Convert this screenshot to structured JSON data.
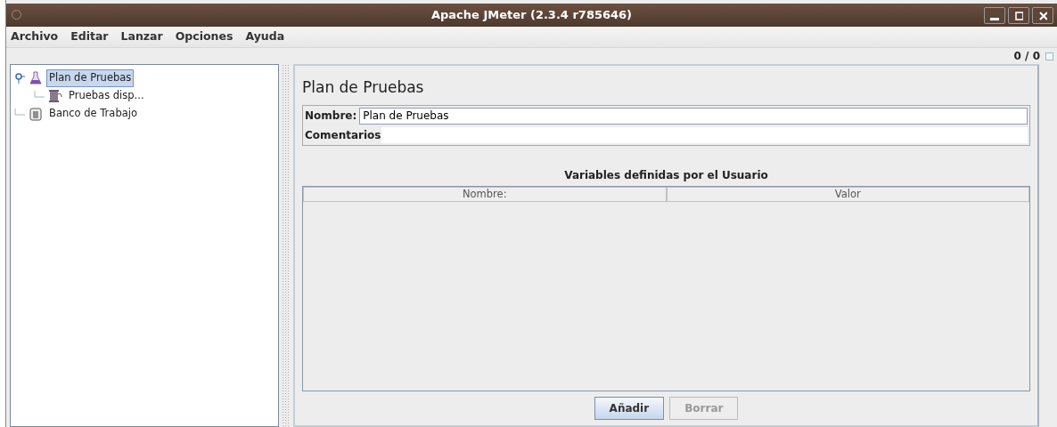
{
  "window": {
    "title": "Apache JMeter (2.3.4 r785646)"
  },
  "menu": [
    {
      "label": "Archivo"
    },
    {
      "label": "Editar"
    },
    {
      "label": "Lanzar"
    },
    {
      "label": "Opciones"
    },
    {
      "label": "Ayuda"
    }
  ],
  "toolbar": {
    "counter": "0 / 0"
  },
  "tree": [
    {
      "label": "Plan de Pruebas",
      "kind": "plan",
      "selected": true,
      "expanded": true,
      "children": [
        {
          "label": "Pruebas disp...",
          "kind": "spool",
          "selected": false
        }
      ]
    },
    {
      "label": "Banco de Trabajo",
      "kind": "workbench",
      "selected": false
    }
  ],
  "panel": {
    "heading": "Plan de Pruebas",
    "name_label": "Nombre:",
    "name_value": "Plan de Pruebas",
    "comments_label": "Comentarios",
    "table": {
      "title": "Variables definidas por el Usuario",
      "columns": [
        "Nombre:",
        "Valor"
      ]
    },
    "buttons": [
      {
        "label": "Añadir",
        "disabled": false
      },
      {
        "label": "Borrar",
        "disabled": true
      }
    ]
  }
}
